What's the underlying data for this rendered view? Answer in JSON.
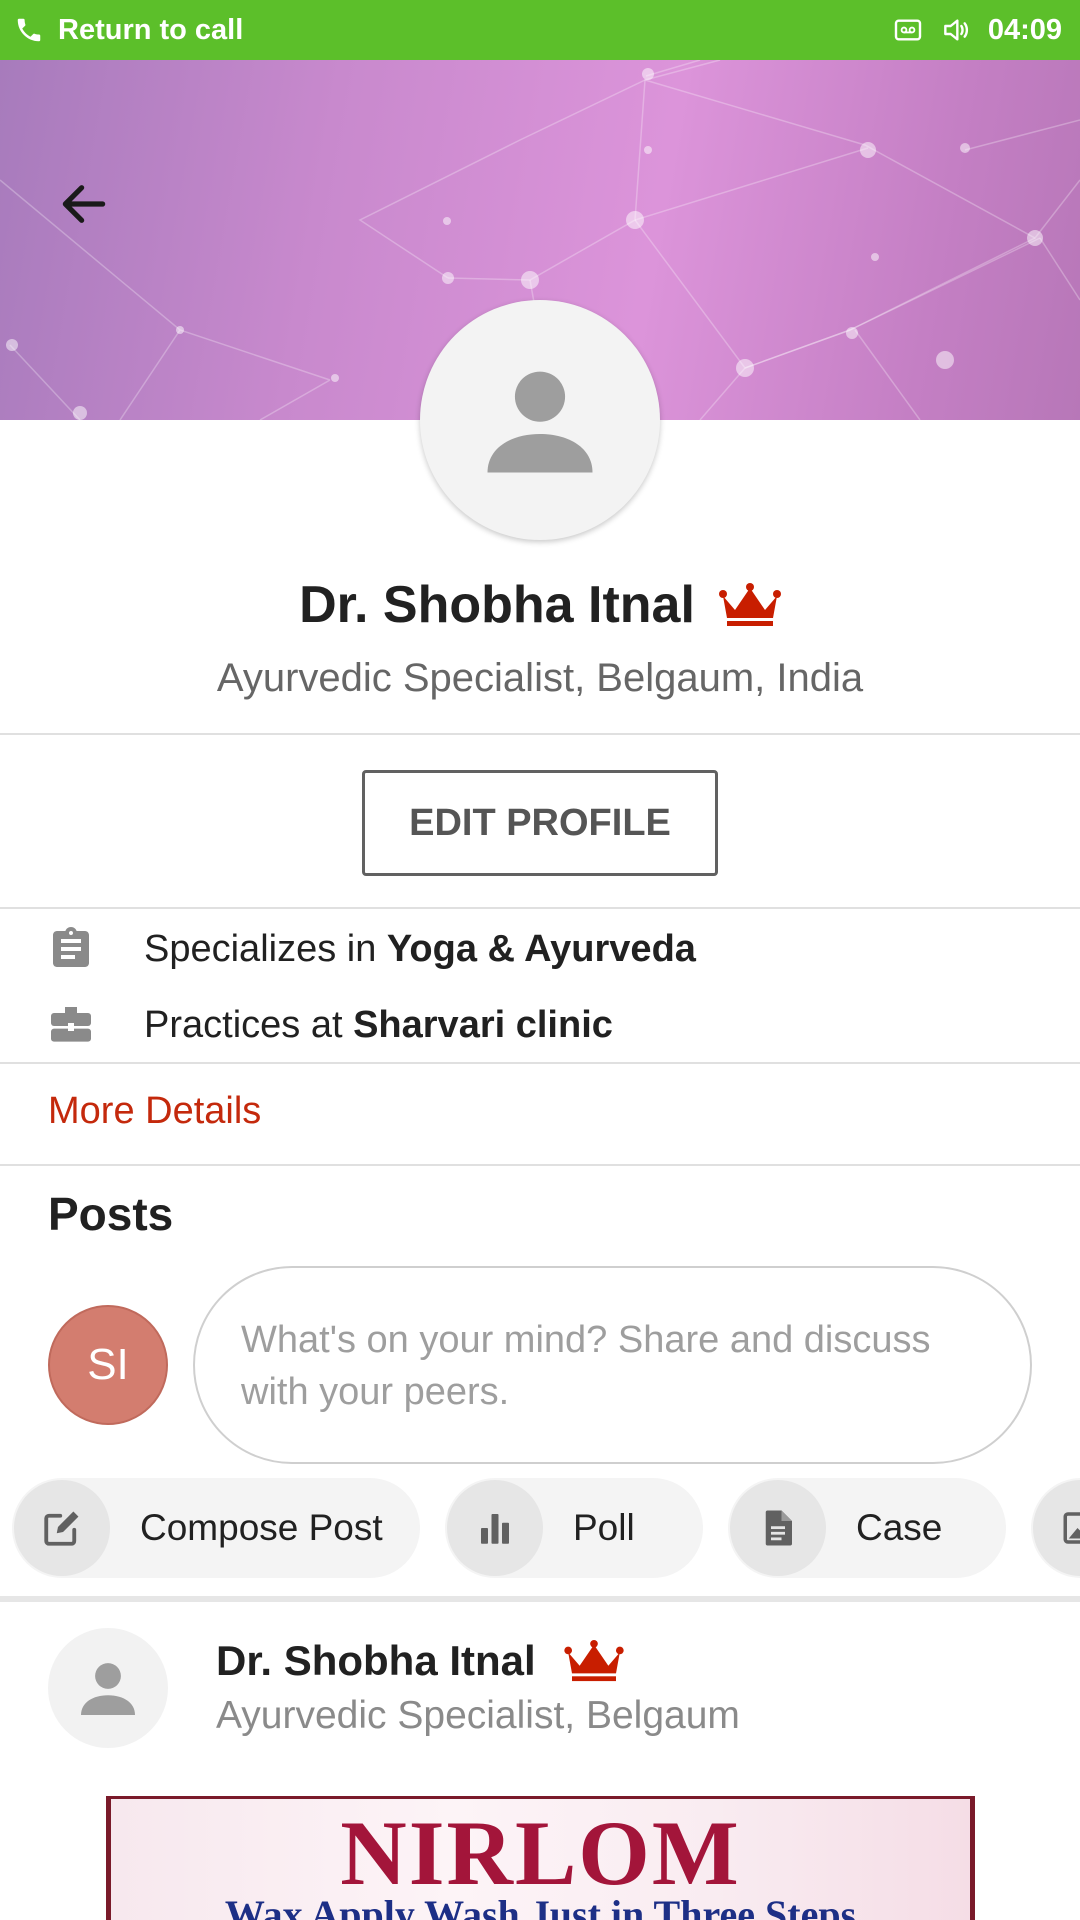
{
  "status_bar": {
    "call_label": "Return to call",
    "time": "04:09",
    "icons": [
      "phone-icon",
      "voicemail-icon",
      "volume-icon"
    ],
    "color": "#5cbf2a"
  },
  "header": {
    "back_icon": "arrow-back-icon",
    "cover_colors": [
      "#a77bbc",
      "#dc94da",
      "#b777b8"
    ]
  },
  "profile": {
    "name": "Dr. Shobha Itnal",
    "badge_icon": "crown-icon",
    "subtitle": "Ayurvedic Specialist, Belgaum, India",
    "edit_label": "EDIT PROFILE"
  },
  "info": {
    "specializes_prefix": "Specializes in ",
    "specializes_value": "Yoga & Ayurveda",
    "practices_prefix": "Practices at ",
    "practices_value": "Sharvari clinic",
    "more_details": "More Details",
    "accent_color": "#c4290c"
  },
  "posts": {
    "title": "Posts",
    "user_initials": "SI",
    "composer_placeholder": "What's on your mind? Share and discuss with your peers.",
    "actions": [
      {
        "label": "Compose Post",
        "icon": "edit-icon"
      },
      {
        "label": "Poll",
        "icon": "bar-chart-icon"
      },
      {
        "label": "Case",
        "icon": "document-icon"
      },
      {
        "label": "",
        "icon": "image-icon"
      }
    ]
  },
  "post": {
    "author": "Dr. Shobha Itnal",
    "author_subtitle": "Ayurvedic Specialist, Belgaum",
    "image_brand": "NIRLOM",
    "image_tagline": "Wax Apply Wash Just in Three Steps"
  }
}
